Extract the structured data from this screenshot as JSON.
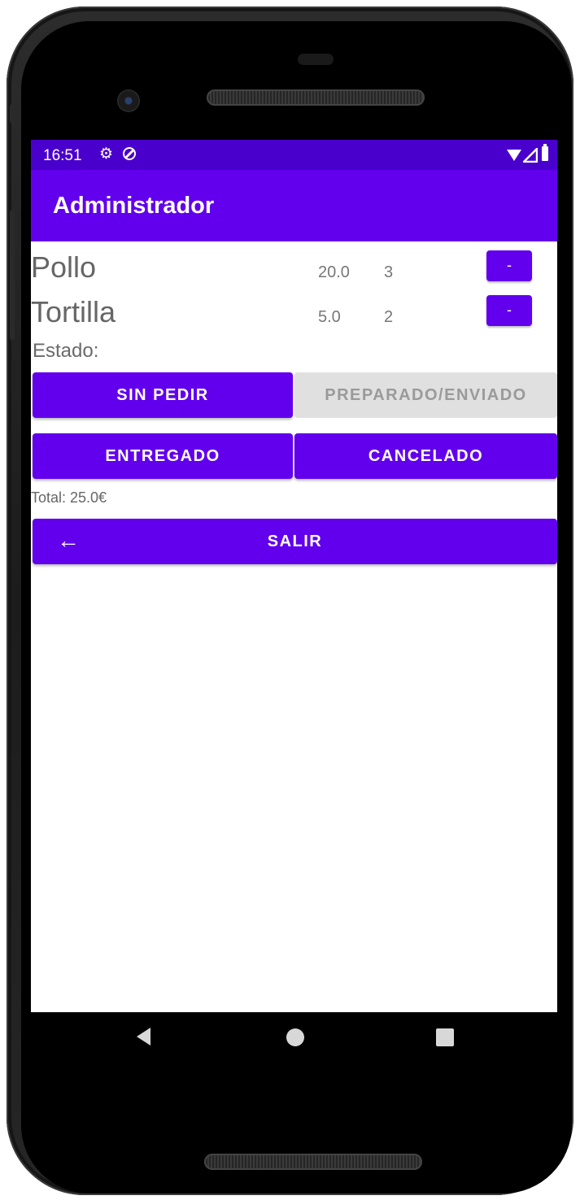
{
  "status_bar": {
    "time": "16:51",
    "gear_icon": "⚙"
  },
  "app_bar": {
    "title": "Administrador"
  },
  "items": [
    {
      "name": "Pollo",
      "price": "20.0",
      "qty": "3",
      "remove_label": "-"
    },
    {
      "name": "Tortilla",
      "price": "5.0",
      "qty": "2",
      "remove_label": "-"
    }
  ],
  "estado": {
    "label": "Estado:",
    "buttons": {
      "sin_pedir": "SIN PEDIR",
      "preparado": "PREPARADO/ENVIADO",
      "entregado": "ENTREGADO",
      "cancelado": "CANCELADO"
    }
  },
  "total": "Total: 25.0€",
  "exit": {
    "label": "SALIR",
    "icon": "←"
  },
  "colors": {
    "primary": "#6200ee",
    "primary_dark": "#4a00cc",
    "disabled_bg": "#e0e0e0",
    "disabled_text": "#9a9a9a"
  },
  "icons": [
    "gear-icon",
    "sync-icon",
    "wifi-icon",
    "signal-icon",
    "battery-icon",
    "back-arrow-icon",
    "nav-back-icon",
    "nav-home-icon",
    "nav-recents-icon"
  ]
}
